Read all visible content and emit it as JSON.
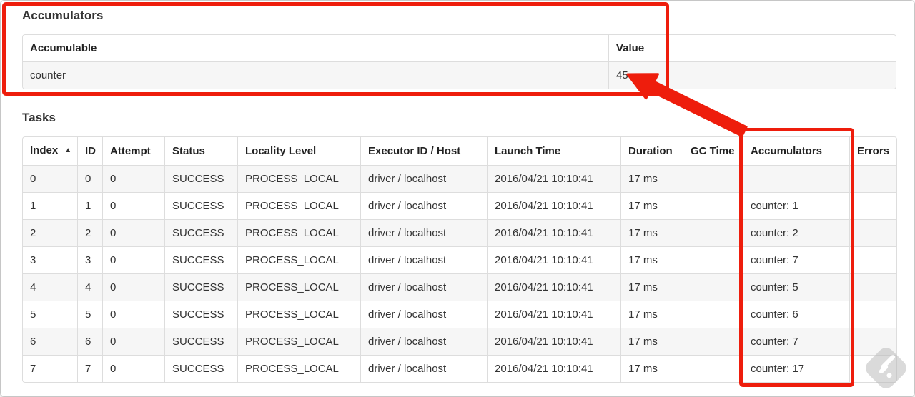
{
  "colors": {
    "annotation_red": "#ee1d0c",
    "table_border": "#dddddd",
    "stripe_background": "#f6f6f6",
    "text": "#333333",
    "watermark_gray": "#bcbcbc"
  },
  "icons": {
    "sort_ascending": "▲",
    "watermark": "stamp-badge"
  },
  "accumulators_section": {
    "title": "Accumulators",
    "table": {
      "headers": [
        "Accumulable",
        "Value"
      ],
      "rows": [
        [
          "counter",
          "45"
        ]
      ]
    }
  },
  "tasks_section": {
    "title": "Tasks",
    "table": {
      "sort_col": 0,
      "sort_icon": "▲",
      "headers": [
        "Index",
        "ID",
        "Attempt",
        "Status",
        "Locality Level",
        "Executor ID / Host",
        "Launch Time",
        "Duration",
        "GC Time",
        "Accumulators",
        "Errors"
      ],
      "rows": [
        [
          "0",
          "0",
          "0",
          "SUCCESS",
          "PROCESS_LOCAL",
          "driver / localhost",
          "2016/04/21 10:10:41",
          "17 ms",
          "",
          "",
          ""
        ],
        [
          "1",
          "1",
          "0",
          "SUCCESS",
          "PROCESS_LOCAL",
          "driver / localhost",
          "2016/04/21 10:10:41",
          "17 ms",
          "",
          "counter: 1",
          ""
        ],
        [
          "2",
          "2",
          "0",
          "SUCCESS",
          "PROCESS_LOCAL",
          "driver / localhost",
          "2016/04/21 10:10:41",
          "17 ms",
          "",
          "counter: 2",
          ""
        ],
        [
          "3",
          "3",
          "0",
          "SUCCESS",
          "PROCESS_LOCAL",
          "driver / localhost",
          "2016/04/21 10:10:41",
          "17 ms",
          "",
          "counter: 7",
          ""
        ],
        [
          "4",
          "4",
          "0",
          "SUCCESS",
          "PROCESS_LOCAL",
          "driver / localhost",
          "2016/04/21 10:10:41",
          "17 ms",
          "",
          "counter: 5",
          ""
        ],
        [
          "5",
          "5",
          "0",
          "SUCCESS",
          "PROCESS_LOCAL",
          "driver / localhost",
          "2016/04/21 10:10:41",
          "17 ms",
          "",
          "counter: 6",
          ""
        ],
        [
          "6",
          "6",
          "0",
          "SUCCESS",
          "PROCESS_LOCAL",
          "driver / localhost",
          "2016/04/21 10:10:41",
          "17 ms",
          "",
          "counter: 7",
          ""
        ],
        [
          "7",
          "7",
          "0",
          "SUCCESS",
          "PROCESS_LOCAL",
          "driver / localhost",
          "2016/04/21 10:10:41",
          "17 ms",
          "",
          "counter: 17",
          ""
        ]
      ]
    }
  }
}
